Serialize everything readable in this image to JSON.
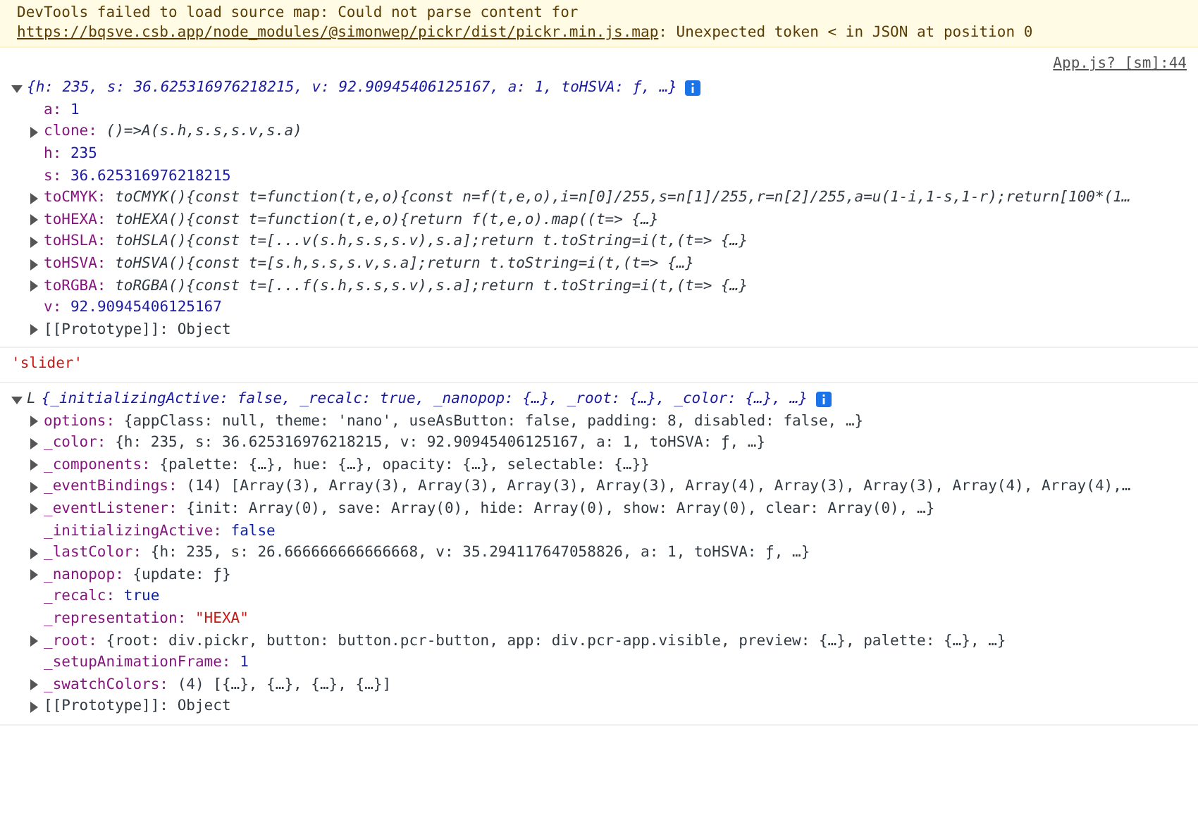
{
  "warning": {
    "text": "DevTools failed to load source map: Could not parse content for ",
    "link": "https://bqsve.csb.app/node_modules/@simonwep/pickr/dist/pickr.min.js.map",
    "rest": ": Unexpected token < in JSON at position 0"
  },
  "messages": [
    {
      "kind": "object",
      "source": "App.js? [sm]:44",
      "summary": "{h: 235, s: 36.625316976218215, v: 92.90945406125167, a: 1, toHSVA: ƒ, …}",
      "expanded": true,
      "children": [
        {
          "key": "a:",
          "value": "1",
          "kind": "number",
          "expandable": false
        },
        {
          "key": "clone:",
          "value": "()=>A(s.h,s.s,s.v,s.a)",
          "kind": "function",
          "expandable": true,
          "expanded": false
        },
        {
          "key": "h:",
          "value": "235",
          "kind": "number",
          "expandable": false
        },
        {
          "key": "s:",
          "value": "36.625316976218215",
          "kind": "number",
          "expandable": false
        },
        {
          "key": "toCMYK:",
          "value": "toCMYK(){const t=function(t,e,o){const n=f(t,e,o),i=n[0]/255,s=n[1]/255,r=n[2]/255,a=u(1-i,1-s,1-r);return[100*(1…",
          "kind": "function",
          "expandable": true,
          "expanded": false
        },
        {
          "key": "toHEXA:",
          "value": "toHEXA(){const t=function(t,e,o){return f(t,e,o).map((t=> {…}",
          "kind": "function",
          "expandable": true,
          "expanded": false
        },
        {
          "key": "toHSLA:",
          "value": "toHSLA(){const t=[...v(s.h,s.s,s.v),s.a];return t.toString=i(t,(t=> {…}",
          "kind": "function",
          "expandable": true,
          "expanded": false
        },
        {
          "key": "toHSVA:",
          "value": "toHSVA(){const t=[s.h,s.s,s.v,s.a];return t.toString=i(t,(t=> {…}",
          "kind": "function",
          "expandable": true,
          "expanded": false
        },
        {
          "key": "toRGBA:",
          "value": "toRGBA(){const t=[...f(s.h,s.s,s.v),s.a];return t.toString=i(t,(t=> {…}",
          "kind": "function",
          "expandable": true,
          "expanded": false
        },
        {
          "key": "v:",
          "value": "92.90945406125167",
          "kind": "number",
          "expandable": false
        },
        {
          "key": "[[Prototype]]:",
          "value": "Object",
          "kind": "internal",
          "expandable": true,
          "expanded": false
        }
      ]
    },
    {
      "kind": "string",
      "text": "'slider'"
    },
    {
      "kind": "object",
      "class_name": "L",
      "summary": "{_initializingActive: false, _recalc: true, _nanopop: {…}, _root: {…}, _color: {…}, …}",
      "expanded": true,
      "children": [
        {
          "key": "options:",
          "value": "{appClass: null, theme: 'nano', useAsButton: false, padding: 8, disabled: false, …}",
          "kind": "object",
          "expandable": true,
          "expanded": false
        },
        {
          "key": "_color:",
          "value": "{h: 235, s: 36.625316976218215, v: 92.90945406125167, a: 1, toHSVA: ƒ, …}",
          "kind": "object",
          "expandable": true,
          "expanded": false
        },
        {
          "key": "_components:",
          "value": "{palette: {…}, hue: {…}, opacity: {…}, selectable: {…}}",
          "kind": "object",
          "expandable": true,
          "expanded": false
        },
        {
          "key": "_eventBindings:",
          "value": "(14) [Array(3), Array(3), Array(3), Array(3), Array(3), Array(4), Array(3), Array(3), Array(4), Array(4),…",
          "kind": "object",
          "expandable": true,
          "expanded": false
        },
        {
          "key": "_eventListener:",
          "value": "{init: Array(0), save: Array(0), hide: Array(0), show: Array(0), clear: Array(0), …}",
          "kind": "object",
          "expandable": true,
          "expanded": false
        },
        {
          "key": "_initializingActive:",
          "value": "false",
          "kind": "boolean",
          "expandable": false
        },
        {
          "key": "_lastColor:",
          "value": "{h: 235, s: 26.666666666666668, v: 35.294117647058826, a: 1, toHSVA: ƒ, …}",
          "kind": "object",
          "expandable": true,
          "expanded": false
        },
        {
          "key": "_nanopop:",
          "value": "{update: ƒ}",
          "kind": "object",
          "expandable": true,
          "expanded": false
        },
        {
          "key": "_recalc:",
          "value": "true",
          "kind": "boolean",
          "expandable": false
        },
        {
          "key": "_representation:",
          "value": "\"HEXA\"",
          "kind": "string",
          "expandable": false
        },
        {
          "key": "_root:",
          "value": "{root: div.pickr, button: button.pcr-button, app: div.pcr-app.visible, preview: {…}, palette: {…}, …}",
          "kind": "object",
          "expandable": true,
          "expanded": false
        },
        {
          "key": "_setupAnimationFrame:",
          "value": "1",
          "kind": "number",
          "expandable": false
        },
        {
          "key": "_swatchColors:",
          "value": "(4) [{…}, {…}, {…}, {…}]",
          "kind": "object",
          "expandable": true,
          "expanded": false
        },
        {
          "key": "[[Prototype]]:",
          "value": "Object",
          "kind": "internal",
          "expandable": true,
          "expanded": false
        }
      ]
    }
  ]
}
